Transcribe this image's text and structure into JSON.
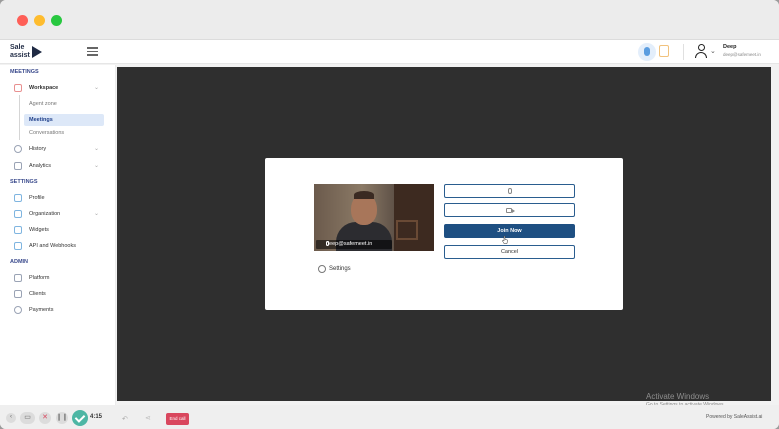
{
  "app": {
    "logo_line1": "Sale",
    "logo_line2": "assist"
  },
  "user": {
    "name": "Deep",
    "email": "deep@safemeet.in"
  },
  "sidebar": {
    "sections": [
      {
        "heading": "MEETINGS",
        "items": [
          {
            "label": "Workspace",
            "expandable": true,
            "sub_items": [
              "Agent zone",
              "Meetings",
              "Conversations"
            ],
            "active_sub_item": "Meetings"
          },
          {
            "label": "History",
            "expandable": true
          },
          {
            "label": "Analytics",
            "expandable": true
          }
        ]
      },
      {
        "heading": "SETTINGS",
        "items": [
          {
            "label": "Profile"
          },
          {
            "label": "Organization",
            "expandable": true
          },
          {
            "label": "Widgets"
          },
          {
            "label": "API and Webhooks"
          }
        ]
      },
      {
        "heading": "ADMIN",
        "items": [
          {
            "label": "Platform"
          },
          {
            "label": "Clients"
          },
          {
            "label": "Payments"
          }
        ]
      }
    ]
  },
  "join_modal": {
    "video_name_tag": "deep@safemeet.in",
    "settings_label": "Settings",
    "join_label": "Join Now",
    "cancel_label": "Cancel",
    "mic_icon": "mic-icon",
    "camera_icon": "camera-icon"
  },
  "watermark": {
    "title": "Activate Windows",
    "subtitle": "Go to Settings to activate Windows."
  },
  "footer": {
    "powered_by": "Powered by SaleAssist.ai"
  },
  "recorder_bar": {
    "timer": "4:15",
    "end_call_label": "End call"
  }
}
